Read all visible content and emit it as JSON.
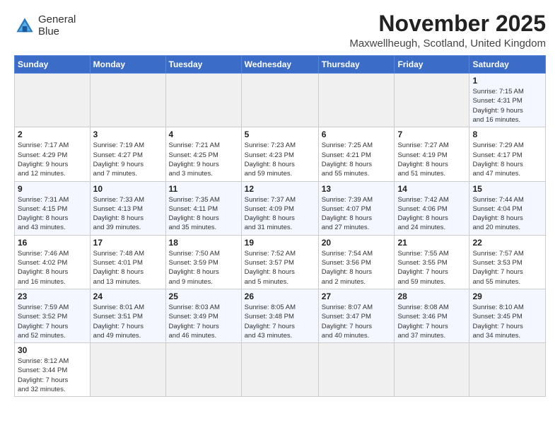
{
  "header": {
    "logo_line1": "General",
    "logo_line2": "Blue",
    "month_title": "November 2025",
    "location": "Maxwellheugh, Scotland, United Kingdom"
  },
  "weekdays": [
    "Sunday",
    "Monday",
    "Tuesday",
    "Wednesday",
    "Thursday",
    "Friday",
    "Saturday"
  ],
  "weeks": [
    [
      {
        "day": "",
        "info": ""
      },
      {
        "day": "",
        "info": ""
      },
      {
        "day": "",
        "info": ""
      },
      {
        "day": "",
        "info": ""
      },
      {
        "day": "",
        "info": ""
      },
      {
        "day": "",
        "info": ""
      },
      {
        "day": "1",
        "info": "Sunrise: 7:15 AM\nSunset: 4:31 PM\nDaylight: 9 hours\nand 16 minutes."
      }
    ],
    [
      {
        "day": "2",
        "info": "Sunrise: 7:17 AM\nSunset: 4:29 PM\nDaylight: 9 hours\nand 12 minutes."
      },
      {
        "day": "3",
        "info": "Sunrise: 7:19 AM\nSunset: 4:27 PM\nDaylight: 9 hours\nand 7 minutes."
      },
      {
        "day": "4",
        "info": "Sunrise: 7:21 AM\nSunset: 4:25 PM\nDaylight: 9 hours\nand 3 minutes."
      },
      {
        "day": "5",
        "info": "Sunrise: 7:23 AM\nSunset: 4:23 PM\nDaylight: 8 hours\nand 59 minutes."
      },
      {
        "day": "6",
        "info": "Sunrise: 7:25 AM\nSunset: 4:21 PM\nDaylight: 8 hours\nand 55 minutes."
      },
      {
        "day": "7",
        "info": "Sunrise: 7:27 AM\nSunset: 4:19 PM\nDaylight: 8 hours\nand 51 minutes."
      },
      {
        "day": "8",
        "info": "Sunrise: 7:29 AM\nSunset: 4:17 PM\nDaylight: 8 hours\nand 47 minutes."
      }
    ],
    [
      {
        "day": "9",
        "info": "Sunrise: 7:31 AM\nSunset: 4:15 PM\nDaylight: 8 hours\nand 43 minutes."
      },
      {
        "day": "10",
        "info": "Sunrise: 7:33 AM\nSunset: 4:13 PM\nDaylight: 8 hours\nand 39 minutes."
      },
      {
        "day": "11",
        "info": "Sunrise: 7:35 AM\nSunset: 4:11 PM\nDaylight: 8 hours\nand 35 minutes."
      },
      {
        "day": "12",
        "info": "Sunrise: 7:37 AM\nSunset: 4:09 PM\nDaylight: 8 hours\nand 31 minutes."
      },
      {
        "day": "13",
        "info": "Sunrise: 7:39 AM\nSunset: 4:07 PM\nDaylight: 8 hours\nand 27 minutes."
      },
      {
        "day": "14",
        "info": "Sunrise: 7:42 AM\nSunset: 4:06 PM\nDaylight: 8 hours\nand 24 minutes."
      },
      {
        "day": "15",
        "info": "Sunrise: 7:44 AM\nSunset: 4:04 PM\nDaylight: 8 hours\nand 20 minutes."
      }
    ],
    [
      {
        "day": "16",
        "info": "Sunrise: 7:46 AM\nSunset: 4:02 PM\nDaylight: 8 hours\nand 16 minutes."
      },
      {
        "day": "17",
        "info": "Sunrise: 7:48 AM\nSunset: 4:01 PM\nDaylight: 8 hours\nand 13 minutes."
      },
      {
        "day": "18",
        "info": "Sunrise: 7:50 AM\nSunset: 3:59 PM\nDaylight: 8 hours\nand 9 minutes."
      },
      {
        "day": "19",
        "info": "Sunrise: 7:52 AM\nSunset: 3:57 PM\nDaylight: 8 hours\nand 5 minutes."
      },
      {
        "day": "20",
        "info": "Sunrise: 7:54 AM\nSunset: 3:56 PM\nDaylight: 8 hours\nand 2 minutes."
      },
      {
        "day": "21",
        "info": "Sunrise: 7:55 AM\nSunset: 3:55 PM\nDaylight: 7 hours\nand 59 minutes."
      },
      {
        "day": "22",
        "info": "Sunrise: 7:57 AM\nSunset: 3:53 PM\nDaylight: 7 hours\nand 55 minutes."
      }
    ],
    [
      {
        "day": "23",
        "info": "Sunrise: 7:59 AM\nSunset: 3:52 PM\nDaylight: 7 hours\nand 52 minutes."
      },
      {
        "day": "24",
        "info": "Sunrise: 8:01 AM\nSunset: 3:51 PM\nDaylight: 7 hours\nand 49 minutes."
      },
      {
        "day": "25",
        "info": "Sunrise: 8:03 AM\nSunset: 3:49 PM\nDaylight: 7 hours\nand 46 minutes."
      },
      {
        "day": "26",
        "info": "Sunrise: 8:05 AM\nSunset: 3:48 PM\nDaylight: 7 hours\nand 43 minutes."
      },
      {
        "day": "27",
        "info": "Sunrise: 8:07 AM\nSunset: 3:47 PM\nDaylight: 7 hours\nand 40 minutes."
      },
      {
        "day": "28",
        "info": "Sunrise: 8:08 AM\nSunset: 3:46 PM\nDaylight: 7 hours\nand 37 minutes."
      },
      {
        "day": "29",
        "info": "Sunrise: 8:10 AM\nSunset: 3:45 PM\nDaylight: 7 hours\nand 34 minutes."
      }
    ],
    [
      {
        "day": "30",
        "info": "Sunrise: 8:12 AM\nSunset: 3:44 PM\nDaylight: 7 hours\nand 32 minutes."
      },
      {
        "day": "",
        "info": ""
      },
      {
        "day": "",
        "info": ""
      },
      {
        "day": "",
        "info": ""
      },
      {
        "day": "",
        "info": ""
      },
      {
        "day": "",
        "info": ""
      },
      {
        "day": "",
        "info": ""
      }
    ]
  ]
}
